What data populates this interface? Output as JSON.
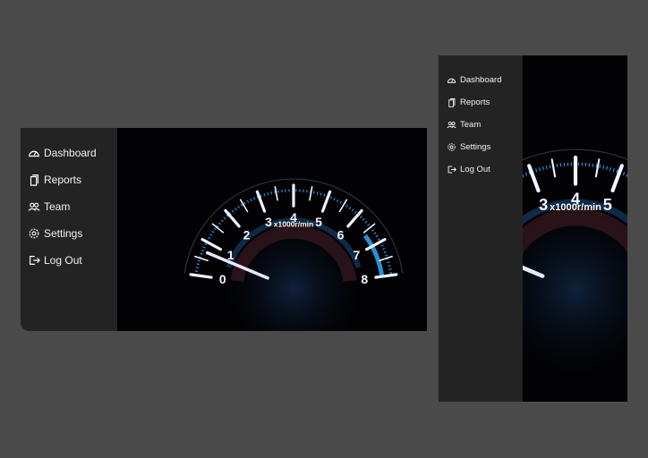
{
  "nav": [
    {
      "label": "Dashboard",
      "icon": "gauge-icon"
    },
    {
      "label": "Reports",
      "icon": "document-icon"
    },
    {
      "label": "Team",
      "icon": "users-icon"
    },
    {
      "label": "Settings",
      "icon": "gear-icon"
    },
    {
      "label": "Log Out",
      "icon": "logout-icon"
    }
  ],
  "gauge": {
    "ticks": [
      "0",
      "1",
      "2",
      "3",
      "4",
      "5",
      "6",
      "7",
      "8"
    ],
    "unit": "x1000r/min"
  },
  "colors": {
    "page_background": "#4a4a4a",
    "sidebar": "#232323",
    "hero_background": "#020205",
    "gauge_accent": "#2a8fd6",
    "needle": "#e8e8ff"
  }
}
